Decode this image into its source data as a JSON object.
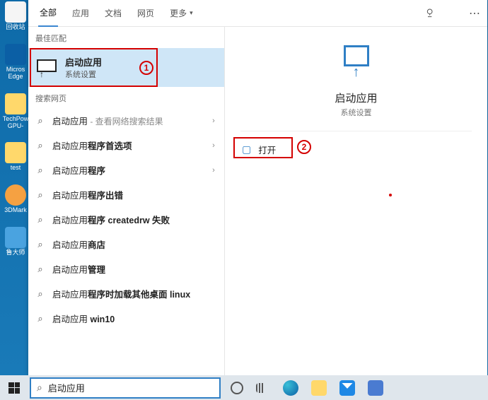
{
  "desktop": {
    "icons": [
      {
        "label": "回收站"
      },
      {
        "label": "Micros Edge"
      },
      {
        "label": "TechPow GPU-"
      },
      {
        "label": "test"
      },
      {
        "label": "3DMark"
      },
      {
        "label": "鲁大师"
      }
    ]
  },
  "tabs": {
    "items": [
      "全部",
      "应用",
      "文档",
      "网页"
    ],
    "more": "更多",
    "active": 0
  },
  "sections": {
    "best": "最佳匹配",
    "web": "搜索网页"
  },
  "best_match": {
    "title": "启动应用",
    "subtitle": "系统设置"
  },
  "web_results": [
    {
      "prefix": "启动应用",
      "bold": "",
      "hint": " - 查看网络搜索结果",
      "chevron": true
    },
    {
      "prefix": "启动应用",
      "bold": "程序首选项",
      "hint": "",
      "chevron": true
    },
    {
      "prefix": "启动应用",
      "bold": "程序",
      "hint": "",
      "chevron": true
    },
    {
      "prefix": "启动应用",
      "bold": "程序出错",
      "hint": "",
      "chevron": false
    },
    {
      "prefix": "启动应用",
      "bold": "程序 createdrw 失败",
      "hint": "",
      "chevron": false
    },
    {
      "prefix": "启动应用",
      "bold": "商店",
      "hint": "",
      "chevron": false
    },
    {
      "prefix": "启动应用",
      "bold": "管理",
      "hint": "",
      "chevron": false
    },
    {
      "prefix": "启动应用",
      "bold": "程序时加载其他桌面 linux",
      "hint": "",
      "chevron": false
    },
    {
      "prefix": "启动应用",
      "bold": " win10",
      "hint": "",
      "chevron": false
    }
  ],
  "details": {
    "title": "启动应用",
    "subtitle": "系统设置",
    "open": "打开"
  },
  "annotations": {
    "one": "1",
    "two": "2"
  },
  "search": {
    "value": "启动应用"
  },
  "colors": {
    "accent": "#2f7fc5",
    "annotation": "#d40000",
    "selected_bg": "#cfe6f7"
  }
}
